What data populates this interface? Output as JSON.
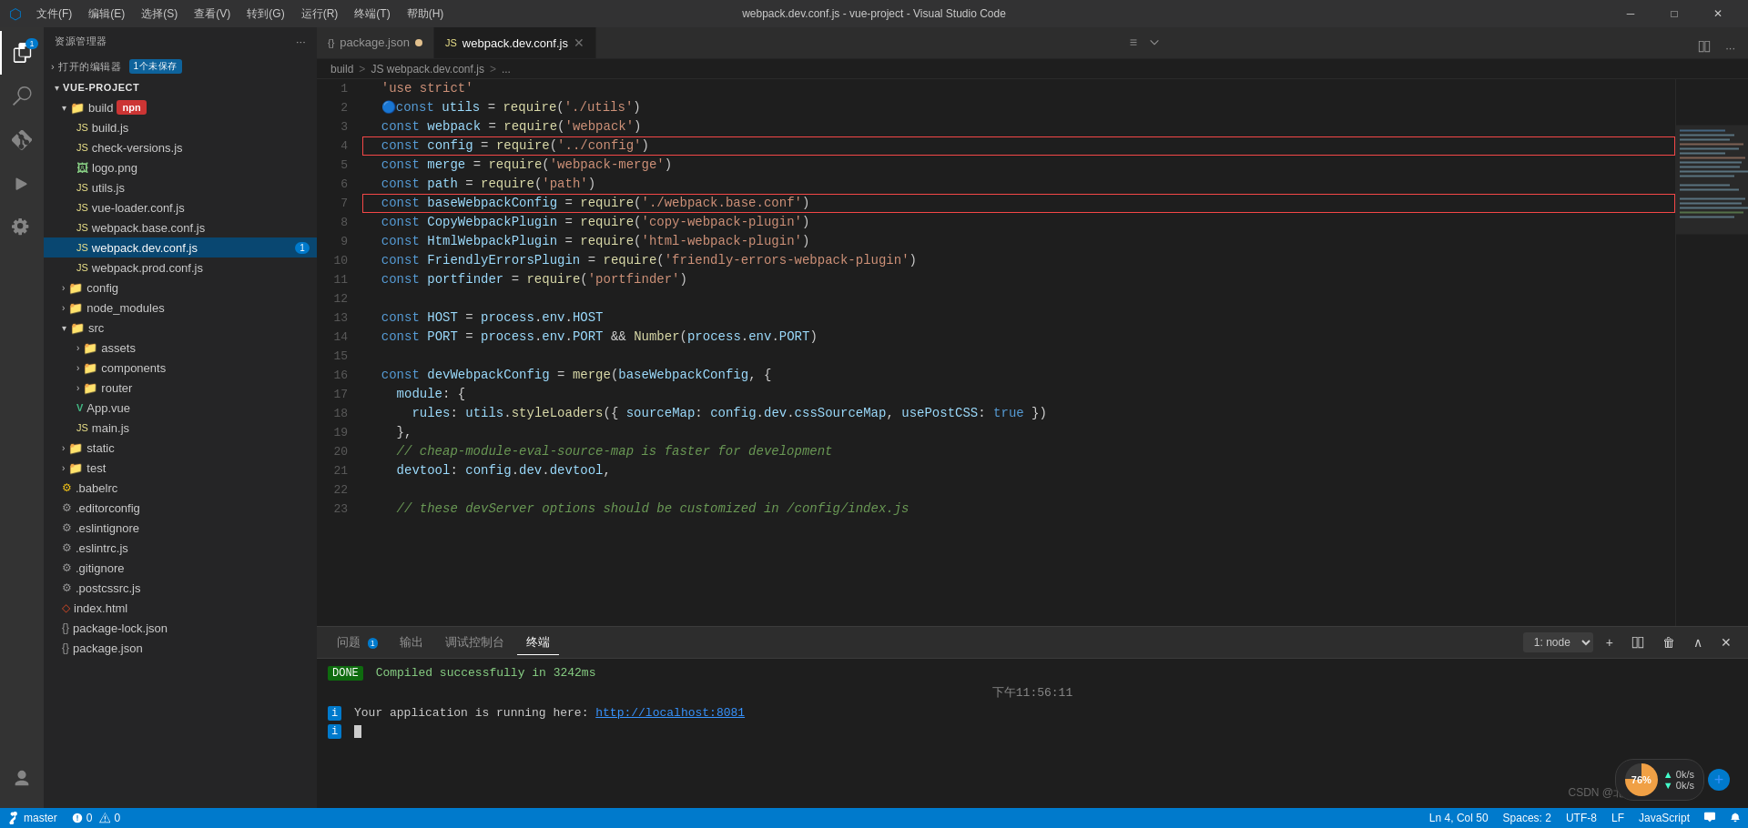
{
  "window": {
    "title": "webpack.dev.conf.js - vue-project - Visual Studio Code",
    "minimize": "─",
    "maximize": "□",
    "close": "✕"
  },
  "menu": {
    "items": [
      "文件(F)",
      "编辑(E)",
      "选择(S)",
      "查看(V)",
      "转到(G)",
      "运行(R)",
      "终端(T)",
      "帮助(H)"
    ]
  },
  "sidebar": {
    "header": "资源管理器",
    "open_editors_label": "打开的编辑器",
    "unsaved": "1个未保存",
    "project_name": "VUE-PROJECT",
    "more_icon": "···",
    "tree": [
      {
        "id": "build",
        "name": "build",
        "type": "folder",
        "expanded": true,
        "indent": 1,
        "arrow": "▾"
      },
      {
        "id": "build.js",
        "name": "build.js",
        "type": "js",
        "indent": 2
      },
      {
        "id": "check-versions.js",
        "name": "check-versions.js",
        "type": "js",
        "indent": 2
      },
      {
        "id": "logo.png",
        "name": "logo.png",
        "type": "png",
        "indent": 2
      },
      {
        "id": "utils.js",
        "name": "utils.js",
        "type": "js",
        "indent": 2
      },
      {
        "id": "vue-loader.conf.js",
        "name": "vue-loader.conf.js",
        "type": "js",
        "indent": 2
      },
      {
        "id": "webpack.base.conf.js",
        "name": "webpack.base.conf.js",
        "type": "js",
        "indent": 2
      },
      {
        "id": "webpack.dev.conf.js",
        "name": "webpack.dev.conf.js",
        "type": "js",
        "indent": 2,
        "active": true,
        "badge": "1"
      },
      {
        "id": "webpack.prod.conf.js",
        "name": "webpack.prod.conf.js",
        "type": "js",
        "indent": 2
      },
      {
        "id": "config",
        "name": "config",
        "type": "folder",
        "indent": 1,
        "arrow": "›"
      },
      {
        "id": "node_modules",
        "name": "node_modules",
        "type": "folder",
        "indent": 1,
        "arrow": "›"
      },
      {
        "id": "src",
        "name": "src",
        "type": "folder",
        "expanded": true,
        "indent": 1,
        "arrow": "▾"
      },
      {
        "id": "assets",
        "name": "assets",
        "type": "folder",
        "indent": 2,
        "arrow": "›"
      },
      {
        "id": "components",
        "name": "components",
        "type": "folder",
        "indent": 2,
        "arrow": "›"
      },
      {
        "id": "router",
        "name": "router",
        "type": "folder",
        "indent": 2,
        "arrow": "›"
      },
      {
        "id": "App.vue",
        "name": "App.vue",
        "type": "vue",
        "indent": 2
      },
      {
        "id": "main.js",
        "name": "main.js",
        "type": "js",
        "indent": 2
      },
      {
        "id": "static",
        "name": "static",
        "type": "folder",
        "indent": 1,
        "arrow": "›"
      },
      {
        "id": "test",
        "name": "test",
        "type": "folder",
        "indent": 1,
        "arrow": "›"
      },
      {
        "id": ".babelrc",
        "name": ".babelrc",
        "type": "config",
        "indent": 1
      },
      {
        "id": ".editorconfig",
        "name": ".editorconfig",
        "type": "config",
        "indent": 1
      },
      {
        "id": ".eslintignore",
        "name": ".eslintignore",
        "type": "config",
        "indent": 1
      },
      {
        "id": ".eslintrc.js",
        "name": ".eslintrc.js",
        "type": "js",
        "indent": 1
      },
      {
        "id": ".gitignore",
        "name": ".gitignore",
        "type": "config",
        "indent": 1
      },
      {
        "id": ".postcssrc.js",
        "name": ".postcssrc.js",
        "type": "js",
        "indent": 1
      },
      {
        "id": "index.html",
        "name": "index.html",
        "type": "html",
        "indent": 1
      },
      {
        "id": "package-lock.json",
        "name": "package-lock.json",
        "type": "json",
        "indent": 1
      },
      {
        "id": "package.json",
        "name": "package.json",
        "type": "json",
        "indent": 1
      }
    ]
  },
  "tabs": [
    {
      "id": "package.json",
      "label": "package.json",
      "type": "json",
      "active": false,
      "dirty": true
    },
    {
      "id": "webpack.dev.conf.js",
      "label": "webpack.dev.conf.js",
      "type": "js",
      "active": true
    }
  ],
  "breadcrumb": {
    "items": [
      "build",
      ">",
      "JS webpack.dev.conf.js",
      ">",
      "..."
    ]
  },
  "code": {
    "lines": [
      {
        "n": 1,
        "content": "  'use strict'"
      },
      {
        "n": 2,
        "content": "  const utils = require('./utils')"
      },
      {
        "n": 3,
        "content": "  const webpack = require('webpack')"
      },
      {
        "n": 4,
        "content": "  const config = require('../config')",
        "highlight": true
      },
      {
        "n": 5,
        "content": "  const merge = require('webpack-merge')"
      },
      {
        "n": 6,
        "content": "  const path = require('path')"
      },
      {
        "n": 7,
        "content": "  const baseWebpackConfig = require('./webpack.base.conf')",
        "highlight": true
      },
      {
        "n": 8,
        "content": "  const CopyWebpackPlugin = require('copy-webpack-plugin')"
      },
      {
        "n": 9,
        "content": "  const HtmlWebpackPlugin = require('html-webpack-plugin')"
      },
      {
        "n": 10,
        "content": "  const FriendlyErrorsPlugin = require('friendly-errors-webpack-plugin')"
      },
      {
        "n": 11,
        "content": "  const portfinder = require('portfinder')"
      },
      {
        "n": 12,
        "content": ""
      },
      {
        "n": 13,
        "content": "  const HOST = process.env.HOST"
      },
      {
        "n": 14,
        "content": "  const PORT = process.env.PORT && Number(process.env.PORT)"
      },
      {
        "n": 15,
        "content": ""
      },
      {
        "n": 16,
        "content": "  const devWebpackConfig = merge(baseWebpackConfig, {"
      },
      {
        "n": 17,
        "content": "    module: {"
      },
      {
        "n": 18,
        "content": "      rules: utils.styleLoaders({ sourceMap: config.dev.cssSourceMap, usePostCSS: true })"
      },
      {
        "n": 19,
        "content": "    },"
      },
      {
        "n": 20,
        "content": "    // cheap-module-eval-source-map is faster for development"
      },
      {
        "n": 21,
        "content": "    devtool: config.dev.devtool,"
      },
      {
        "n": 22,
        "content": ""
      },
      {
        "n": 23,
        "content": "    // these devServer options should be customized in /config/index.js"
      }
    ]
  },
  "terminal": {
    "tabs": [
      {
        "id": "problems",
        "label": "问题",
        "badge": "1"
      },
      {
        "id": "output",
        "label": "输出"
      },
      {
        "id": "debug",
        "label": "调试控制台"
      },
      {
        "id": "terminal",
        "label": "终端",
        "active": true
      }
    ],
    "select_label": "1: node",
    "done_label": "DONE",
    "compile_msg": "Compiled successfully in 3242ms",
    "time_label": "下午11:56:11",
    "run_msg": "Your application is running here: http://localhost:8081",
    "cursor": ""
  },
  "status": {
    "branch": "master",
    "errors": "0",
    "warnings": "0",
    "ln_col": "Ln 4, Col 50",
    "spaces": "Spaces: 2",
    "encoding": "UTF-8",
    "eol": "LF",
    "lang": "JavaScript",
    "csdn": "CSDN @北城小林"
  },
  "widget": {
    "percent": "76%",
    "stat1": "0k/s",
    "stat2": "0k/s"
  }
}
